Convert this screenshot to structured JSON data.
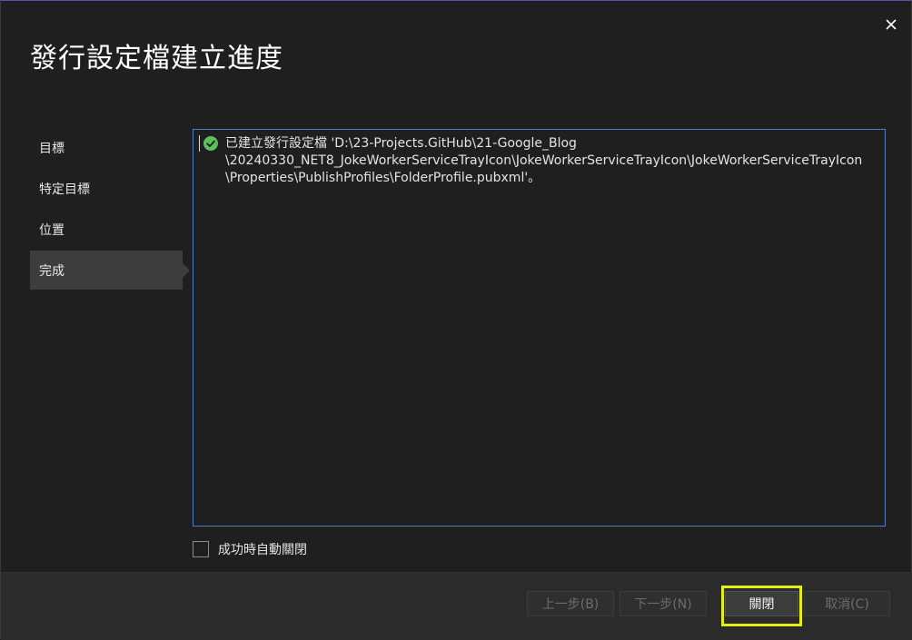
{
  "dialog": {
    "title": "發行設定檔建立進度",
    "close_icon": "close-icon"
  },
  "nav": {
    "items": [
      {
        "label": "目標",
        "active": false
      },
      {
        "label": "特定目標",
        "active": false
      },
      {
        "label": "位置",
        "active": false
      },
      {
        "label": "完成",
        "active": true
      }
    ]
  },
  "output": {
    "status_icon": "check-circle-icon",
    "status_color": "#5cc15c",
    "lines": [
      "已建立發行設定檔 'D:\\23-Projects.GitHub\\21-Google_Blog",
      "\\20240330_NET8_JokeWorkerServiceTrayIcon\\JokeWorkerServiceTrayIcon\\JokeWorkerServiceTrayIcon",
      "\\Properties\\PublishProfiles\\FolderProfile.pubxml'。"
    ]
  },
  "options": {
    "auto_close_label": "成功時自動關閉",
    "auto_close_checked": false
  },
  "footer": {
    "prev_label": "上一步(B)",
    "next_label": "下一步(N)",
    "close_label": "關閉",
    "cancel_label": "取消(C)",
    "highlight_color": "#e5ef13"
  }
}
